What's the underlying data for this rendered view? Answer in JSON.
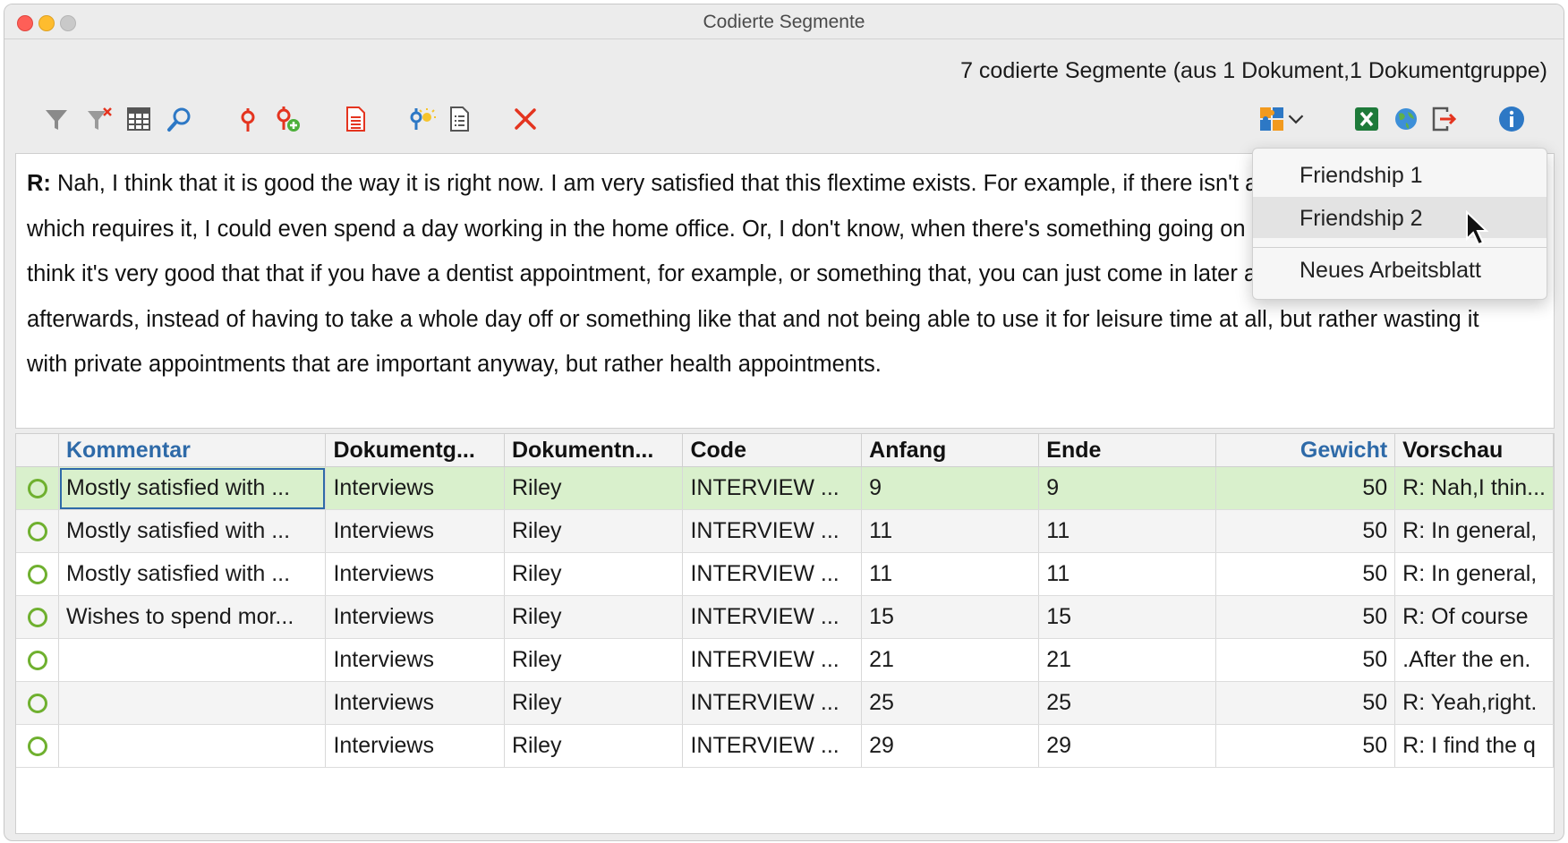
{
  "window": {
    "title": "Codierte Segmente",
    "summary": "7 codierte Segmente (aus 1 Dokument,1 Dokumentgruppe)"
  },
  "toolbar": {
    "icons": [
      "filter-icon",
      "clear-filter-icon",
      "table-columns-icon",
      "search-icon",
      "code-pin-icon",
      "add-code-icon",
      "document-icon",
      "light-bulb-icon",
      "list-document-icon",
      "delete-icon",
      "puzzle-icon",
      "chevron-down-icon",
      "excel-icon",
      "globe-icon",
      "export-icon",
      "info-icon"
    ],
    "colors": {
      "red": "#e4341f",
      "blue": "#2d78c5",
      "grey": "#8a8a8a",
      "green": "#1e7a3a",
      "orange": "#f29a1e"
    }
  },
  "text": {
    "speaker": "R:",
    "body": "Nah, I think that it is good the way it is right now. I am very satisfied that this flextime exists. For example, if there isn't anything on the agenda which requires it, I could even spend a day working in the home office. Or, I don't know, when there's something going on at home or whatever. I think it's very good that that if you have a dentist appointment, for example, or something that, you can just come in later and then go there afterwards, instead of having to take a whole day off or something like that and not being able to use it for leisure time at all, but rather wasting it with private appointments that are important anyway, but rather health appointments."
  },
  "table": {
    "headers": [
      "Kommentar",
      "Dokumentg...",
      "Dokumentn...",
      "Code",
      "Anfang",
      "Ende",
      "Gewicht",
      "Vorschau"
    ],
    "header_colors": {
      "Kommentar": "#2e6aa8",
      "Gewicht": "#2e6aa8"
    },
    "rows": [
      [
        "Mostly satisfied with ...",
        "Interviews",
        "Riley",
        "INTERVIEW ...",
        "9",
        "9",
        "50",
        "R: Nah,I thin..."
      ],
      [
        "Mostly satisfied with ...",
        "Interviews",
        "Riley",
        "INTERVIEW ...",
        "11",
        "11",
        "50",
        "R: In general,"
      ],
      [
        "Mostly satisfied with ...",
        "Interviews",
        "Riley",
        "INTERVIEW ...",
        "11",
        "11",
        "50",
        "R: In general,"
      ],
      [
        "Wishes to spend mor...",
        "Interviews",
        "Riley",
        "INTERVIEW ...",
        "15",
        "15",
        "50",
        "R: Of course"
      ],
      [
        "",
        "Interviews",
        "Riley",
        "INTERVIEW ...",
        "21",
        "21",
        "50",
        ".After the en."
      ],
      [
        "",
        "Interviews",
        "Riley",
        "INTERVIEW ...",
        "25",
        "25",
        "50",
        "R: Yeah,right."
      ],
      [
        "",
        "Interviews",
        "Riley",
        "INTERVIEW ...",
        "29",
        "29",
        "50",
        "R: I find the q"
      ]
    ],
    "selected_row": 0
  },
  "menu": {
    "items": [
      "Friendship 1",
      "Friendship 2",
      "Neues Arbeitsblatt"
    ],
    "hovered": "Friendship 2"
  }
}
